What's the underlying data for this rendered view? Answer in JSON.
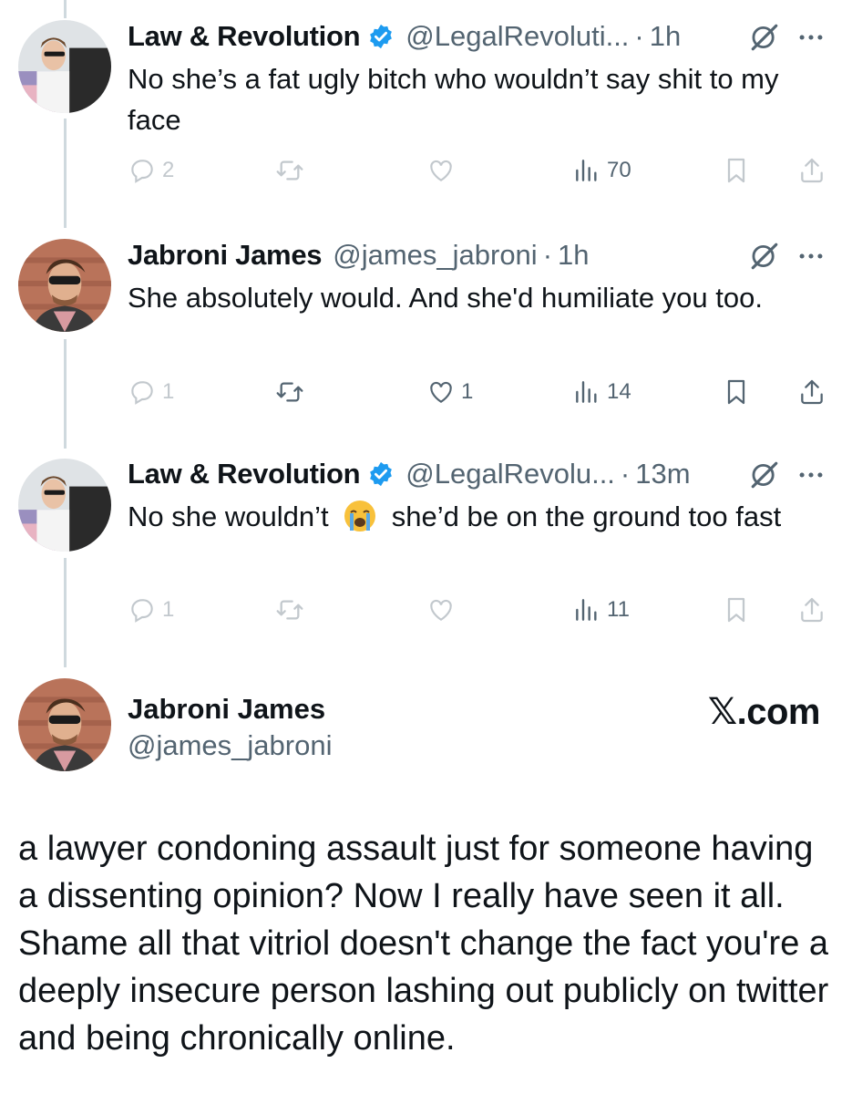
{
  "tweets": [
    {
      "name": "Law & Revolution",
      "verified": true,
      "handle": "@LegalRevoluti...",
      "dot": "·",
      "time": "1h",
      "text": "No she’s a fat ugly bitch who wouldn’t say shit to my face",
      "replies": "2",
      "retweets": "",
      "likes": "",
      "views": "70",
      "faded_actions": true
    },
    {
      "name": "Jabroni James",
      "verified": false,
      "handle": "@james_jabroni",
      "dot": "·",
      "time": "1h",
      "text": "She absolutely would. And she'd humiliate you too.",
      "replies": "1",
      "retweets": "",
      "likes": "1",
      "views": "14",
      "faded_actions": false
    },
    {
      "name": "Law & Revolution",
      "verified": true,
      "handle": "@LegalRevolu...",
      "dot": "·",
      "time": "13m",
      "text_before_emoji": "No she wouldn’t ",
      "emoji": "loudly-crying-face-emoji",
      "text_after_emoji": " she’d be on the ground too fast",
      "replies": "1",
      "retweets": "",
      "likes": "",
      "views": "11",
      "faded_actions": true
    }
  ],
  "profile": {
    "name": "Jabroni James",
    "handle": "@james_jabroni",
    "site_label": "𝕏.com"
  },
  "caption": "a lawyer condoning assault just for someone having a dissenting opinion? Now I really have seen it all. Shame all that vitriol doesn't change the fact you're a deeply insecure person lashing out publicly on twitter and being chronically online.",
  "colors": {
    "text": "#0f1419",
    "secondary": "#536471",
    "verified_blue": "#1d9bf0",
    "thread_line": "#cfd9de"
  },
  "icons": [
    "reply-icon",
    "retweet-icon",
    "like-icon",
    "views-icon",
    "bookmark-icon",
    "share-icon",
    "grok-icon",
    "more-icon",
    "verified-icon"
  ]
}
